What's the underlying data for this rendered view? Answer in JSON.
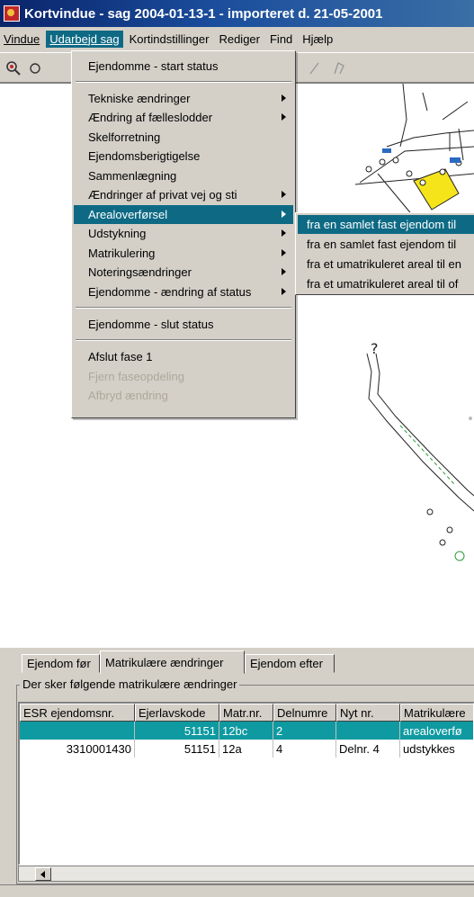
{
  "window": {
    "title": "Kortvindue - sag 2004-01-13-1 - importeret d. 21-05-2001"
  },
  "menubar": {
    "items": [
      "Vindue",
      "Udarbejd sag",
      "Kortindstillinger",
      "Rediger",
      "Find",
      "Hjælp"
    ]
  },
  "dropdown": {
    "items": [
      "Ejendomme - start status",
      "Tekniske ændringer",
      "Ændring af fælleslodder",
      "Skelforretning",
      "Ejendomsberigtigelse",
      "Sammenlægning",
      "Ændringer af privat vej og sti",
      "Arealoverførsel",
      "Udstykning",
      "Matrikulering",
      "Noteringsændringer",
      "Ejendomme - ændring af status",
      "Ejendomme - slut status",
      "Afslut fase 1",
      "Fjern faseopdeling",
      "Afbryd ændring"
    ]
  },
  "submenu": {
    "items": [
      "fra en samlet fast ejendom til",
      "fra en samlet fast ejendom til",
      "fra et umatrikuleret areal til en",
      "fra et umatrikuleret areal til of"
    ]
  },
  "tabs": [
    "Ejendom før",
    "Matrikulære ændringer",
    "Ejendom efter"
  ],
  "group": {
    "label": "Der sker følgende matrikulære ændringer"
  },
  "table": {
    "columns": [
      "ESR ejendomsnr.",
      "Ejerlavskode",
      "Matr.nr.",
      "Delnumre",
      "Nyt nr.",
      "Matrikulære"
    ],
    "rows": [
      {
        "esr": "",
        "ejerlav": "51151",
        "matr": "12bc",
        "del": "2",
        "nyt": "",
        "type": "arealoverfø"
      },
      {
        "esr": "3310001430",
        "ejerlav": "51151",
        "matr": "12a",
        "del": "4",
        "nyt": "Delnr. 4",
        "type": "udstykkes"
      }
    ]
  },
  "colors": {
    "highlight": "#0e6a84",
    "row_selected": "#0e9aa0",
    "titlebar": "#0a246a"
  },
  "icons": [
    "app-icon",
    "zoom-icon",
    "submenu-arrow-icon",
    "scroll-left-icon"
  ]
}
